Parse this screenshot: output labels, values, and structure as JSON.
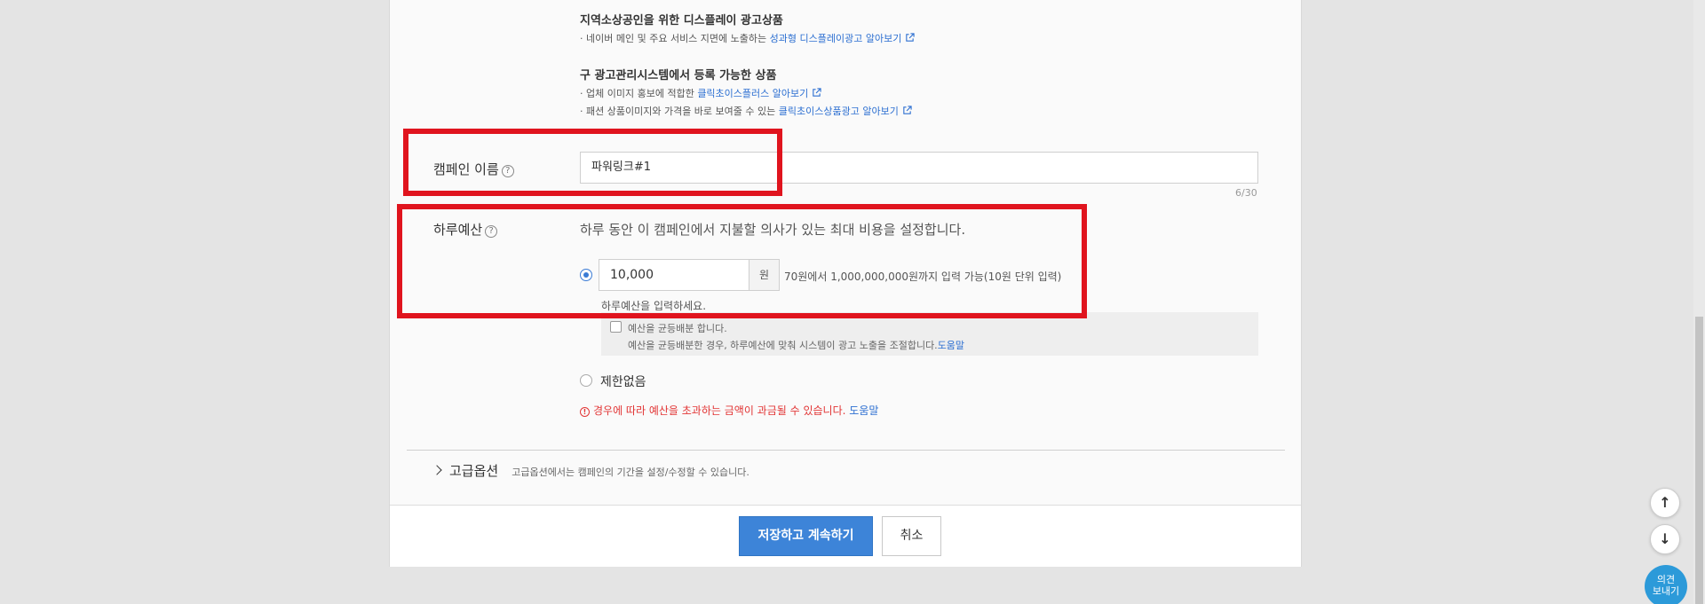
{
  "product_section": {
    "local_title": "지역소상공인을 위한 디스플레이 광고상품",
    "local_line_prefix": "네이버 메인 및 주요 서비스 지면에 노출하는",
    "local_link": "성과형 디스플레이광고 알아보기",
    "legacy_title": "구 광고관리시스템에서 등록 가능한 상품",
    "legacy_line1_prefix": "업체 이미지 홍보에 적합한",
    "legacy_line1_link": "클릭초이스플러스 알아보기",
    "legacy_line2_prefix": "패션 상품이미지와 가격을 바로 보여줄 수 있는",
    "legacy_line2_link": "클릭초이스상품광고 알아보기"
  },
  "campaign_name": {
    "label": "캠페인 이름",
    "value": "파워링크#1",
    "counter": "6/30"
  },
  "daily_budget": {
    "label": "하루예산",
    "description": "하루 동안 이 캠페인에서 지불할 의사가 있는 최대 비용을 설정합니다.",
    "value": "10,000",
    "unit": "원",
    "range_hint": "70원에서 1,000,000,000원까지 입력 가능(10원 단위 입력)",
    "input_hint": "하루예산을 입력하세요.",
    "distribute_label": "예산을 균등배분 합니다.",
    "distribute_desc": "예산을 균등배분한 경우, 하루예산에 맞춰 시스템이 광고 노출을 조절합니다.",
    "distribute_help": "도움말",
    "unlimited_label": "제한없음",
    "warning": "경우에 따라 예산을 초과하는 금액이 과금될 수 있습니다.",
    "warning_help": "도움말"
  },
  "advanced": {
    "title": "고급옵션",
    "desc": "고급옵션에서는 캠페인의 기간을 설정/수정할 수 있습니다."
  },
  "footer": {
    "save_label": "저장하고 계속하기",
    "cancel_label": "취소"
  },
  "floating": {
    "up_icon": "↑",
    "down_icon": "↓",
    "feedback_line1": "의견",
    "feedback_line2": "보내기"
  },
  "colors": {
    "accent": "#3d84d8",
    "link": "#2c6fd1",
    "warning": "#e23535",
    "highlight_box": "#e0141e"
  }
}
